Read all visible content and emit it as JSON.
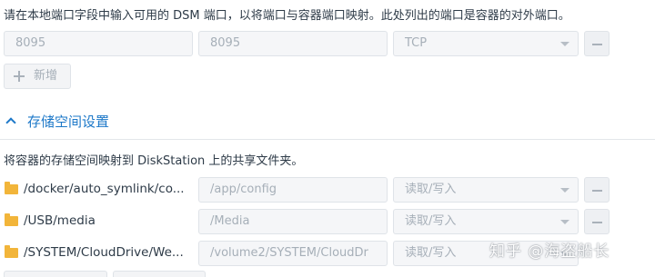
{
  "intro_text": "请在本地端口字段中输入可用的 DSM 端口，以将端口与容器端口映射。此处列出的端口是容器的对外端口。",
  "port_row": {
    "local_port": "8095",
    "container_port": "8095",
    "protocol": "TCP"
  },
  "add_button_label": "新增",
  "storage_section": {
    "title": "存储空间设置",
    "description": "将容器的存储空间映射到 DiskStation 上的共享文件夹。",
    "rows": [
      {
        "folder": "/docker/auto_symlink/co...",
        "mount_path": "/app/config",
        "permission": "读取/写入"
      },
      {
        "folder": "/USB/media",
        "mount_path": "/Media",
        "permission": "读取/写入"
      },
      {
        "folder": "/SYSTEM/CloudDrive/We...",
        "mount_path": "/volume2/SYSTEM/CloudDr",
        "permission": "读取/写入"
      }
    ]
  },
  "watermark": "知乎 @海盗船长",
  "icons": {
    "add": "plus-icon",
    "remove": "minus-icon",
    "folder": "folder-icon",
    "collapse": "chevron-up-icon",
    "dropdown": "caret-down-icon"
  },
  "colors": {
    "accent": "#1d78c8",
    "folder": "#f2b53a",
    "field_bg": "#f5f6f8",
    "border": "#dfe3e8"
  }
}
